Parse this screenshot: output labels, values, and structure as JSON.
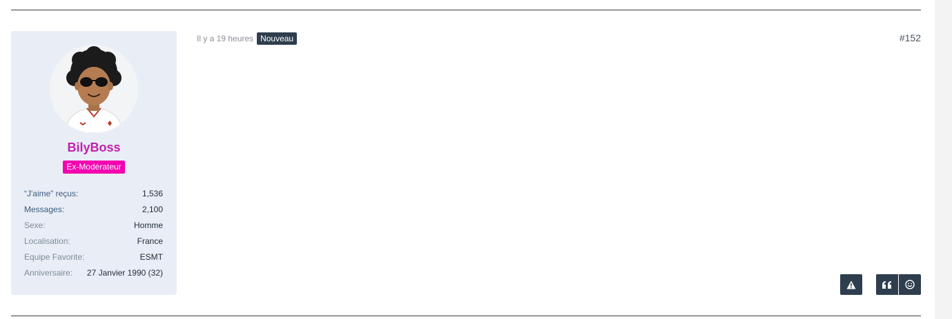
{
  "post": {
    "time": "Il y a 19 heures",
    "new_badge": "Nouveau",
    "number": "#152"
  },
  "user": {
    "name": "BilyBoss",
    "role": "Ex-Modérateur",
    "stats": [
      {
        "label": "“J'aime” reçus:",
        "value": "1,536"
      },
      {
        "label": "Messages:",
        "value": "2,100"
      },
      {
        "label": "Sexe:",
        "value": "Homme"
      },
      {
        "label": "Localisation:",
        "value": "France"
      },
      {
        "label": "Equipe Favorite:",
        "value": "ESMT"
      },
      {
        "label": "Anniversaire:",
        "value": "27 Janvier 1990 (32)"
      }
    ]
  },
  "actions": {
    "report_icon": "warning-icon",
    "quote_icon": "quote-icon",
    "react_icon": "smiley-icon"
  },
  "colors": {
    "username": "#c21fae",
    "role_badge": "#f400b0",
    "button_bg": "#2f3e4e",
    "card_bg": "#e9eef6"
  }
}
